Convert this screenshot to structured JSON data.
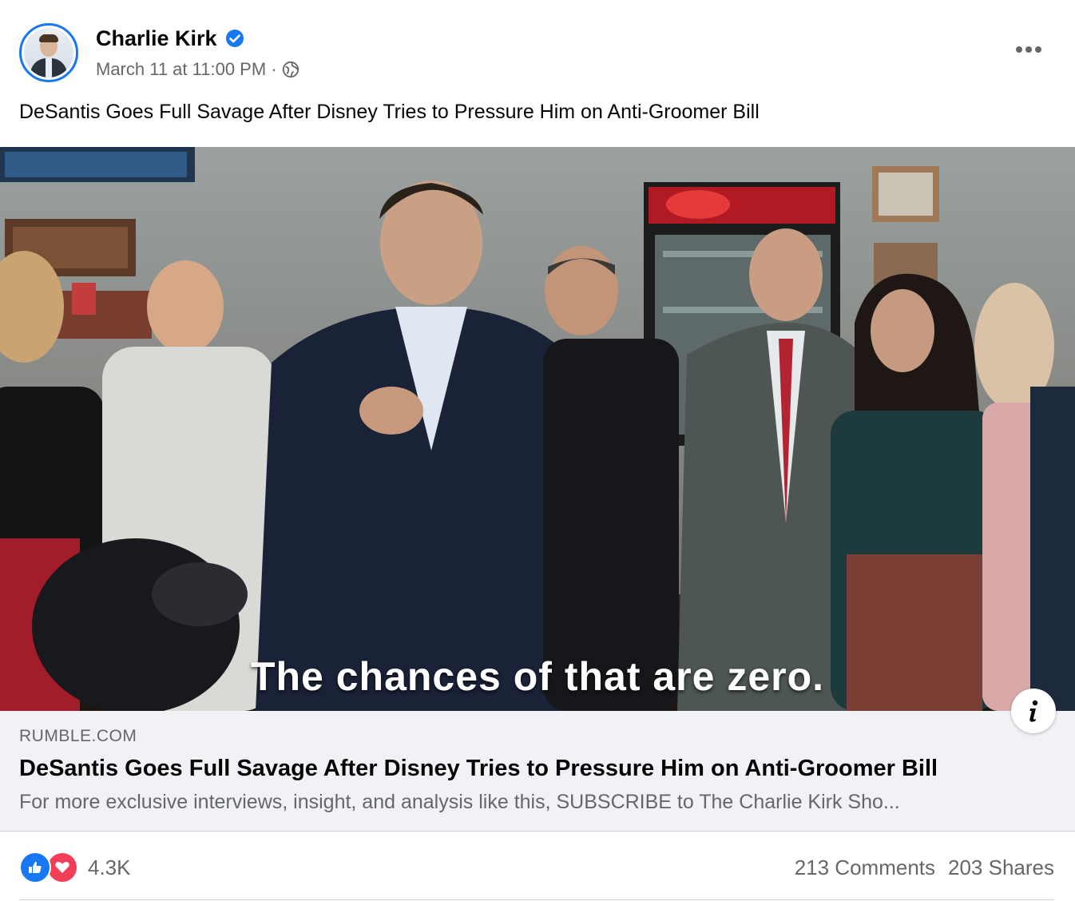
{
  "post": {
    "author": "Charlie Kirk",
    "timestamp": "March 11 at 11:00 PM",
    "separator": "·",
    "privacy_icon": "globe-icon",
    "verified_icon": "verified-badge-icon",
    "more_icon": "more-options-icon",
    "caption": "DeSantis Goes Full Savage After Disney Tries to Pressure Him on Anti-Groomer Bill"
  },
  "video": {
    "subtitle": "The chances of that are zero.",
    "info_icon": "info-icon"
  },
  "link": {
    "domain": "RUMBLE.COM",
    "title": "DeSantis Goes Full Savage After Disney Tries to Pressure Him on Anti-Groomer Bill",
    "description": "For more exclusive interviews, insight, and analysis like this, SUBSCRIBE to The Charlie Kirk Sho..."
  },
  "engagement": {
    "reaction_icons": [
      "like-icon",
      "love-icon"
    ],
    "reaction_count": "4.3K",
    "comments": "213 Comments",
    "shares": "203 Shares"
  },
  "colors": {
    "brand_blue": "#1877f2",
    "love_red": "#f33e58",
    "secondary_text": "#65676b",
    "link_bg": "#f0f2f5"
  }
}
